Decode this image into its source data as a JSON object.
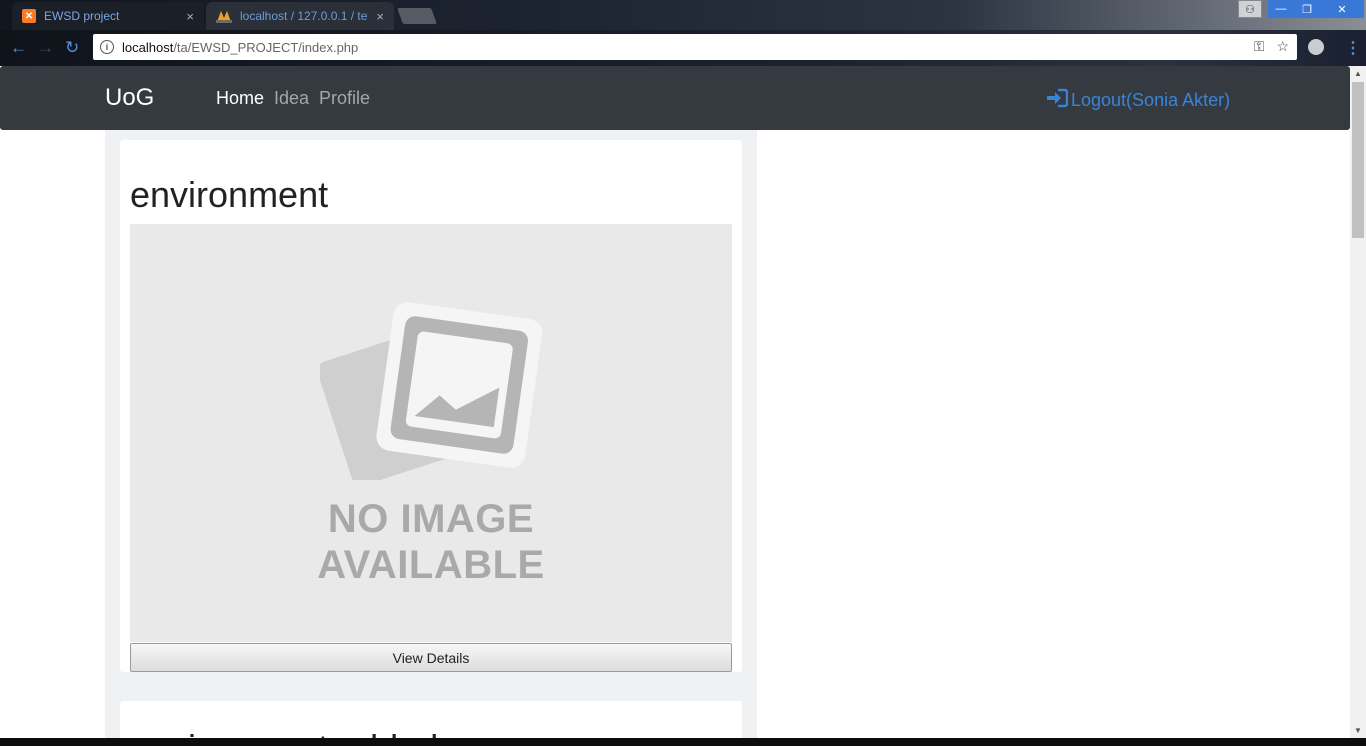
{
  "browser": {
    "tabs": [
      {
        "title": "EWSD project",
        "icon": "xampp-icon",
        "active": true
      },
      {
        "title": "localhost / 127.0.0.1 / te",
        "icon": "phpmyadmin-icon",
        "active": false
      }
    ],
    "close_glyph": "×",
    "address": {
      "host": "localhost",
      "path": "/ta/EWSD_PROJECT/index.php"
    },
    "info_glyph": "i",
    "back_glyph": "←",
    "forward_glyph": "→",
    "reload_glyph": "↻",
    "key_glyph": "⚿",
    "star_glyph": "☆",
    "menu_glyph": "⋮",
    "window": {
      "user_glyph": "⚇",
      "min_glyph": "—",
      "max_glyph": "❐",
      "close_glyph": "✕"
    }
  },
  "navbar": {
    "brand": "UoG",
    "links": [
      "Home",
      "Idea",
      "Profile"
    ],
    "active_link": "Home",
    "logout": {
      "icon": "sign-in-icon",
      "glyph": "⇥",
      "label": "Logout(Sonia Akter)"
    }
  },
  "cards": [
    {
      "title": "environment",
      "image_placeholder": {
        "line1": "NO IMAGE",
        "line2": "AVAILABLE"
      },
      "button": "View Details"
    },
    {
      "title": "environment added"
    }
  ],
  "colors": {
    "navbar_bg": "#343a40",
    "link_blue": "#3a84d6",
    "page_bg": "#ffffff"
  }
}
